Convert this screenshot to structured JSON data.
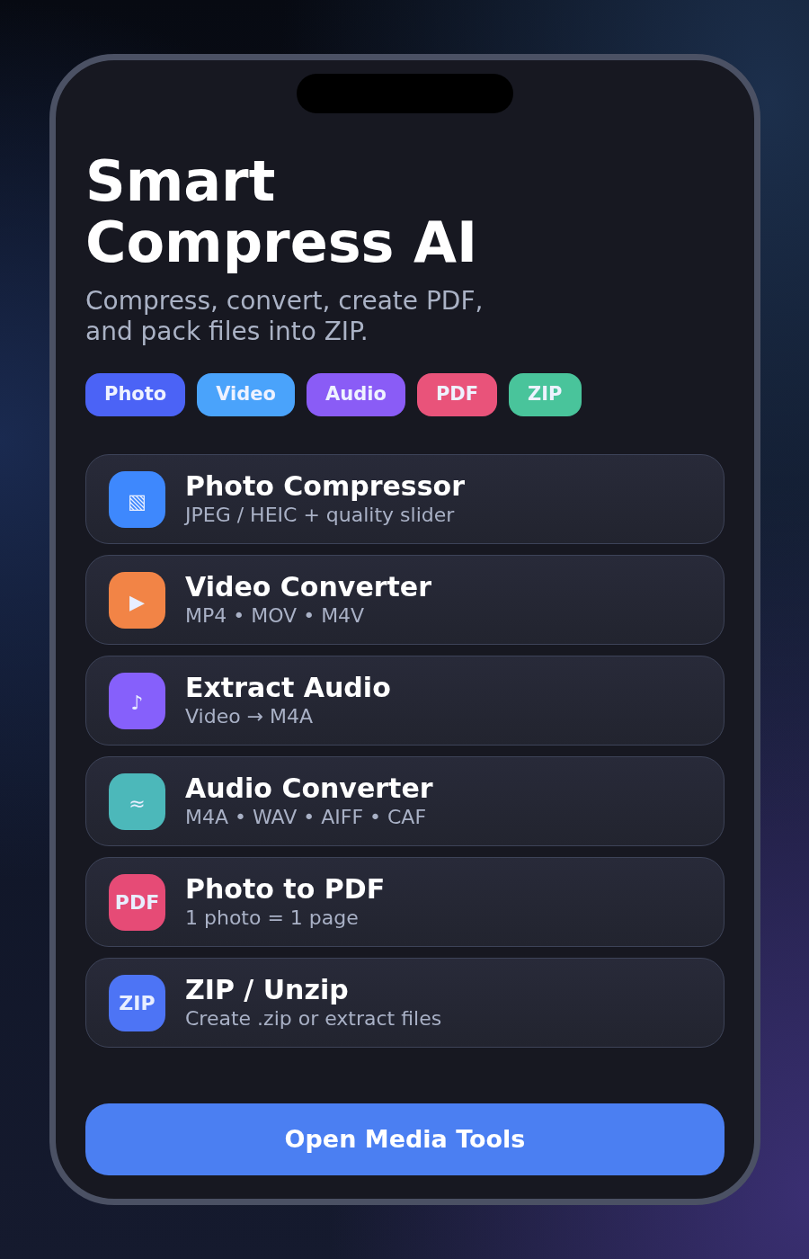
{
  "app": {
    "title": "Smart Compress AI",
    "subtitle": "Compress, convert, create PDF, and pack files into ZIP."
  },
  "tags": [
    {
      "label": "Photo",
      "color": "#4b63f6"
    },
    {
      "label": "Video",
      "color": "#4aa3fb"
    },
    {
      "label": "Audio",
      "color": "#8a5cf6"
    },
    {
      "label": "PDF",
      "color": "#e9537a"
    },
    {
      "label": "ZIP",
      "color": "#49c49b"
    }
  ],
  "tools": [
    {
      "kind": "glyph",
      "glyph": "▧",
      "color": "#3e88fd",
      "title": "Photo Compressor",
      "subtitle": "JPEG / HEIC + quality slider"
    },
    {
      "kind": "glyph",
      "glyph": "▶",
      "color": "#f28446",
      "title": "Video Converter",
      "subtitle": "MP4 • MOV • M4V"
    },
    {
      "kind": "glyph",
      "glyph": "♪",
      "color": "#8660fb",
      "title": "Extract Audio",
      "subtitle": "Video → M4A"
    },
    {
      "kind": "glyph",
      "glyph": "≈",
      "color": "#4cb8ba",
      "title": "Audio Converter",
      "subtitle": "M4A • WAV • AIFF • CAF"
    },
    {
      "kind": "label",
      "glyph": "PDF",
      "color": "#e64b76",
      "title": "Photo to PDF",
      "subtitle": "1 photo = 1 page"
    },
    {
      "kind": "label",
      "glyph": "ZIP",
      "color": "#4d74f5",
      "title": "ZIP / Unzip",
      "subtitle": "Create .zip or extract files"
    }
  ],
  "primary_button": {
    "label": "Open Media Tools"
  }
}
